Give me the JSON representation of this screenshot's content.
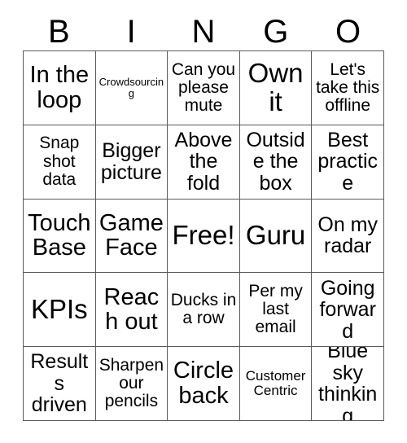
{
  "header": {
    "letters": [
      "B",
      "I",
      "N",
      "G",
      "O"
    ]
  },
  "grid": {
    "rows": 5,
    "columns": 5,
    "border_color": "#5a5a5a",
    "background_color": "#ffffff",
    "text_color": "#000000",
    "cells": [
      {
        "text": "In the loop",
        "size": "xl"
      },
      {
        "text": "Crowdsourcing",
        "size": "xs"
      },
      {
        "text": "Can you please mute",
        "size": "md"
      },
      {
        "text": "Own it",
        "size": "xxl"
      },
      {
        "text": "Let's take this offline",
        "size": "md"
      },
      {
        "text": "Snap shot data",
        "size": "md"
      },
      {
        "text": "Bigger picture",
        "size": "lg"
      },
      {
        "text": "Above the fold",
        "size": "lg"
      },
      {
        "text": "Outside the box",
        "size": "lg"
      },
      {
        "text": "Best practice",
        "size": "lg"
      },
      {
        "text": "Touch Base",
        "size": "xl"
      },
      {
        "text": "Game Face",
        "size": "xl"
      },
      {
        "text": "Free!",
        "size": "xxl"
      },
      {
        "text": "Guru",
        "size": "xxl"
      },
      {
        "text": "On my radar",
        "size": "lg"
      },
      {
        "text": "KPIs",
        "size": "xxl"
      },
      {
        "text": "Reach out",
        "size": "xl"
      },
      {
        "text": "Ducks in a row",
        "size": "md"
      },
      {
        "text": "Per my last email",
        "size": "md"
      },
      {
        "text": "Going forward",
        "size": "lg"
      },
      {
        "text": "Results driven",
        "size": "lg"
      },
      {
        "text": "Sharpen our pencils",
        "size": "md"
      },
      {
        "text": "Circle back",
        "size": "xl"
      },
      {
        "text": "Customer Centric",
        "size": "sm"
      },
      {
        "text": "Blue sky thinking",
        "size": "lg"
      }
    ]
  }
}
